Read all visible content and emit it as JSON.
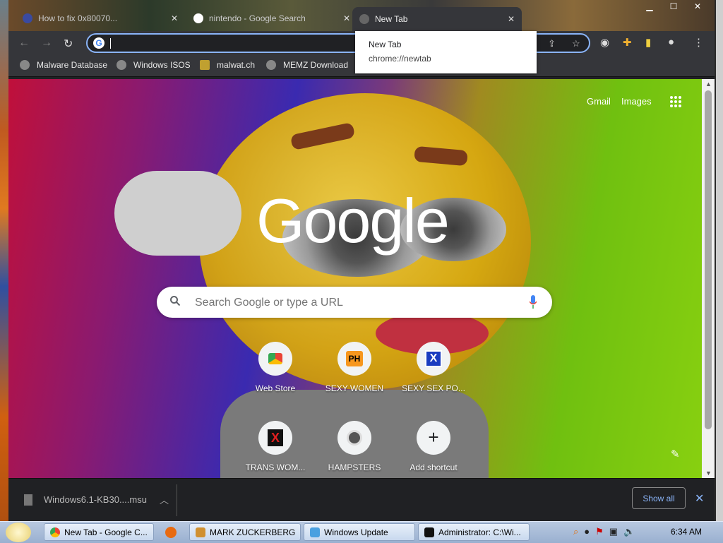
{
  "tabs": [
    {
      "title": "How to fix 0x80070...",
      "close": "✕"
    },
    {
      "title": "nintendo - Google Search",
      "close": "✕"
    },
    {
      "title": "New Tab",
      "close": "✕"
    }
  ],
  "tooltip": {
    "title": "New Tab",
    "url": "chrome://newtab"
  },
  "omnibox": {
    "value": "",
    "placeholder": ""
  },
  "bookmarks": [
    {
      "label": "Malware Database"
    },
    {
      "label": "Windows ISOS"
    },
    {
      "label": "malwat.ch"
    },
    {
      "label": "MEMZ Download"
    }
  ],
  "header_links": {
    "gmail": "Gmail",
    "images": "Images"
  },
  "logo": "Google",
  "search": {
    "placeholder": "Search Google or type a URL"
  },
  "shortcuts": [
    {
      "label": "Web Store",
      "icon": "webstore-icon"
    },
    {
      "label": "SEXY WOMEN",
      "badge": "PH",
      "icon": "ph-icon"
    },
    {
      "label": "SEXY SEX PO...",
      "badge": "X",
      "icon": "x-blue-icon"
    },
    {
      "label": "TRANS WOM...",
      "badge": "X",
      "icon": "x-red-icon"
    },
    {
      "label": "HAMPSTERS",
      "icon": "hamster-icon"
    },
    {
      "label": "Add shortcut",
      "badge": "+",
      "icon": "plus-icon"
    }
  ],
  "download": {
    "filename": "Windows6.1-KB30....msu",
    "show_all": "Show all"
  },
  "taskbar": {
    "items": [
      {
        "label": "New Tab - Google C..."
      },
      {
        "label": "MARK ZUCKERBERG"
      },
      {
        "label": "Windows Update"
      },
      {
        "label": "Administrator: C:\\Wi..."
      }
    ],
    "clock": "6:34 AM"
  },
  "colors": {
    "accent": "#8ab4f8",
    "toolbar": "#35363a",
    "frame": "#202124"
  }
}
